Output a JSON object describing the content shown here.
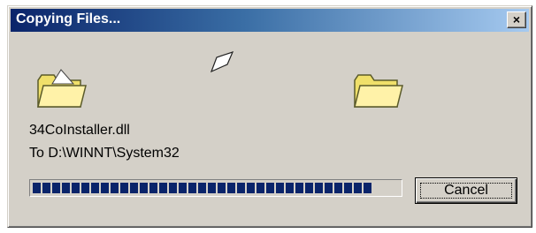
{
  "window": {
    "title": "Copying Files...",
    "close_label": "×"
  },
  "icons": {
    "source": "folder-open-icon",
    "flying": "flying-paper-icon",
    "destination": "folder-open-icon"
  },
  "status": {
    "file_name": "34CoInstaller.dll",
    "destination": "To D:\\WINNT\\System32"
  },
  "progress": {
    "fraction": 0.95,
    "color": "#0a246a"
  },
  "buttons": {
    "cancel_label": "Cancel"
  }
}
